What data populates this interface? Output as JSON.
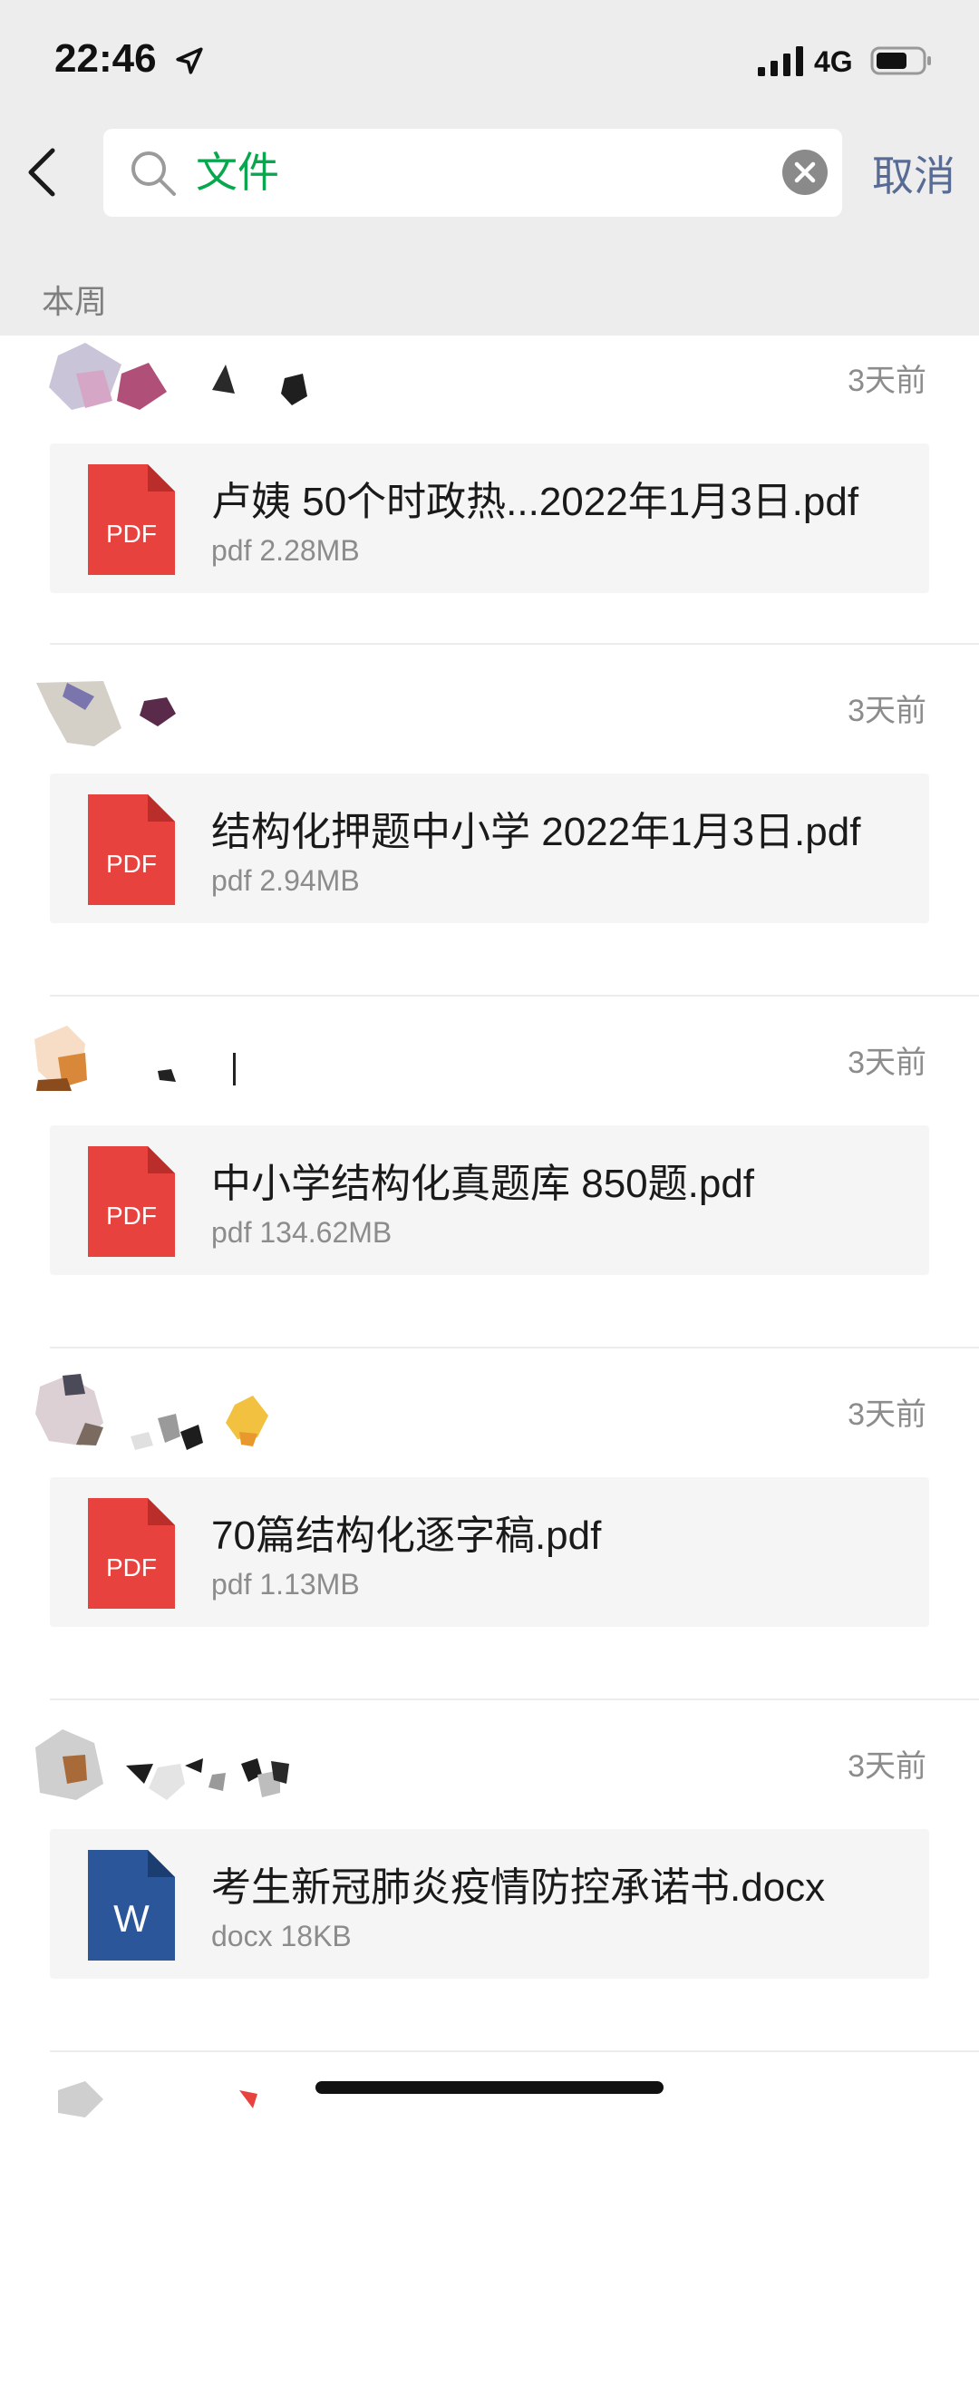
{
  "status_bar": {
    "time": "22:46",
    "network": "4G"
  },
  "search": {
    "query": "文件",
    "cancel_label": "取消"
  },
  "section": {
    "header": "本周"
  },
  "results": [
    {
      "time": "3天前",
      "file_name": "卢姨 50个时政热...2022年1月3日.pdf",
      "file_type": "pdf",
      "file_size": "pdf 2.28MB",
      "icon_label": "PDF"
    },
    {
      "time": "3天前",
      "file_name": "结构化押题中小学 2022年1月3日.pdf",
      "file_type": "pdf",
      "file_size": "pdf 2.94MB",
      "icon_label": "PDF"
    },
    {
      "time": "3天前",
      "file_name": "中小学结构化真题库 850题.pdf",
      "file_type": "pdf",
      "file_size": "pdf 134.62MB",
      "icon_label": "PDF"
    },
    {
      "time": "3天前",
      "file_name": "70篇结构化逐字稿.pdf",
      "file_type": "pdf",
      "file_size": "pdf 1.13MB",
      "icon_label": "PDF"
    },
    {
      "time": "3天前",
      "file_name": "考生新冠肺炎疫情防控承诺书.docx",
      "file_type": "docx",
      "file_size": "docx 18KB",
      "icon_label": "W"
    }
  ],
  "colors": {
    "accent_green": "#07a84d",
    "link_blue": "#576b95",
    "pdf_red": "#e8423f",
    "word_blue": "#2b579a"
  }
}
